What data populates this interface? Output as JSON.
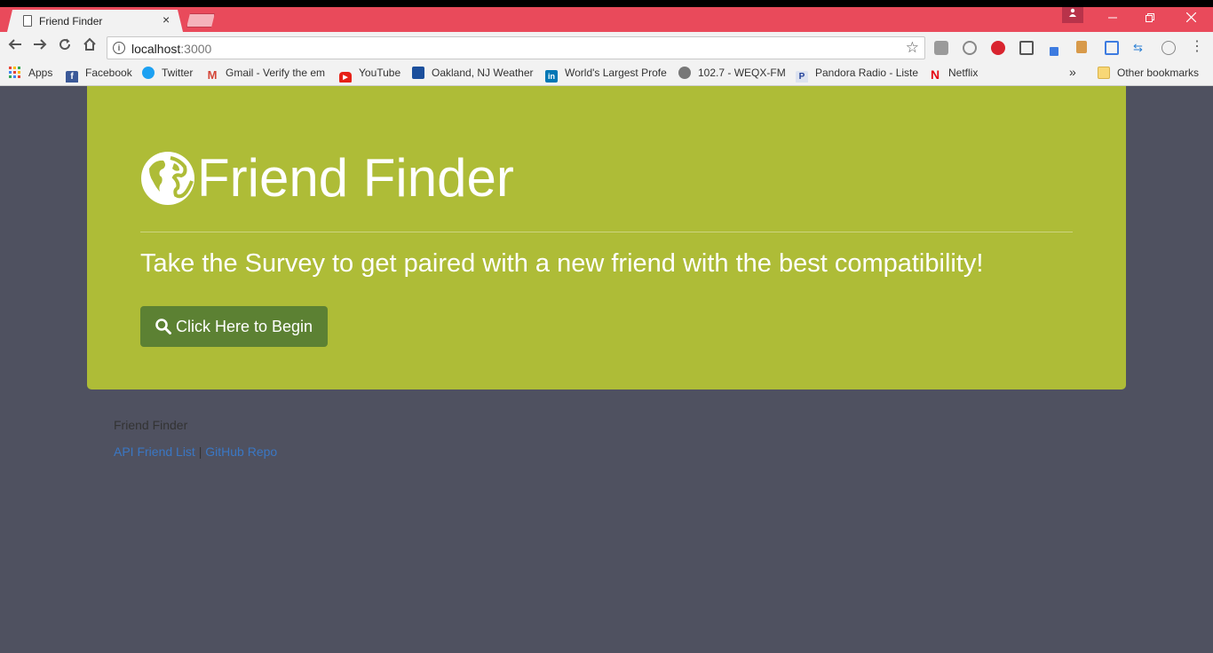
{
  "browser": {
    "tab_title": "Friend Finder",
    "tab_close": "×",
    "url_host": "localhost",
    "url_port": ":3000",
    "bookmarks": [
      {
        "label": "Apps",
        "icon": "apps-grid-icon",
        "color": "#4285f4"
      },
      {
        "label": "Facebook",
        "icon": "facebook-icon",
        "color": "#3b5998"
      },
      {
        "label": "Twitter",
        "icon": "twitter-icon",
        "color": "#1da1f2"
      },
      {
        "label": "Gmail - Verify the em",
        "icon": "gmail-icon",
        "color": "#d44638"
      },
      {
        "label": "YouTube",
        "icon": "youtube-icon",
        "color": "#e62117"
      },
      {
        "label": "Oakland, NJ Weather",
        "icon": "weather-channel-icon",
        "color": "#1b4f9c"
      },
      {
        "label": "World's Largest Profe",
        "icon": "linkedin-icon",
        "color": "#0077b5"
      },
      {
        "label": "102.7 - WEQX-FM",
        "icon": "radio-icon",
        "color": "#666666"
      },
      {
        "label": "Pandora Radio - Liste",
        "icon": "pandora-icon",
        "color": "#224099"
      },
      {
        "label": "Netflix",
        "icon": "netflix-icon",
        "color": "#e50914"
      }
    ],
    "bookmarks_overflow": "»",
    "other_bookmarks": "Other bookmarks"
  },
  "jumbotron": {
    "title": "Friend Finder",
    "lead": "Take the Survey to get paired with a new friend with the best compatibility!",
    "button_label": "Click Here to Begin"
  },
  "footer": {
    "name": "Friend Finder",
    "link_api": "API Friend List",
    "separator": "|",
    "link_github": "GitHub Repo"
  },
  "colors": {
    "tab_bar": "#e94a5b",
    "background": "#4f5160",
    "jumbotron": "#aebc37",
    "button": "#5c8133",
    "link": "#3a77c4"
  }
}
